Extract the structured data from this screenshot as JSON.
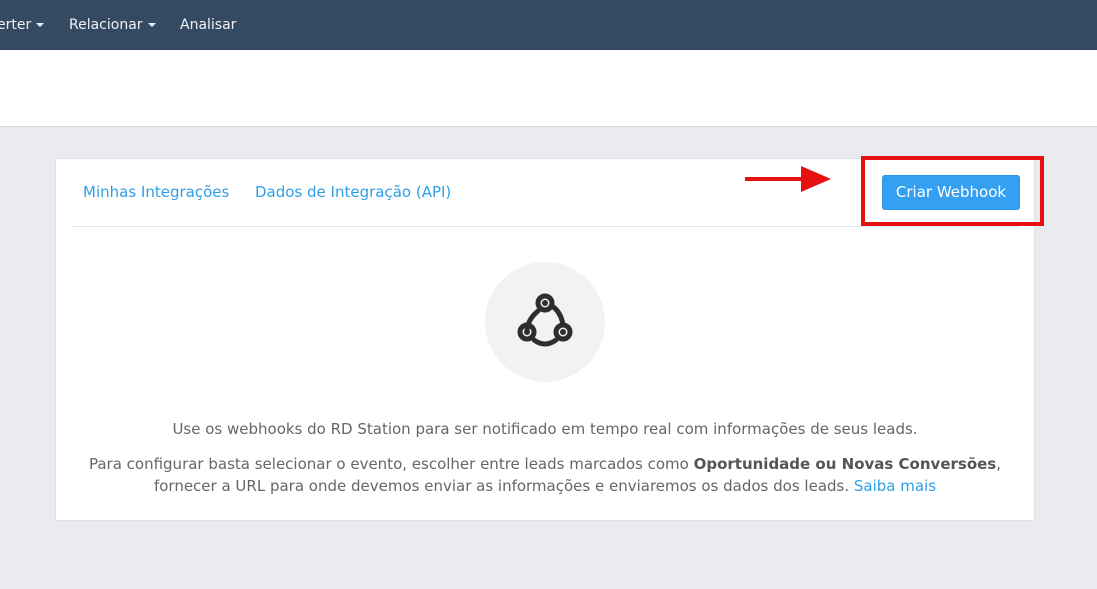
{
  "topnav": {
    "items": [
      {
        "label": "erter",
        "has_caret": true
      },
      {
        "label": "Relacionar",
        "has_caret": true
      },
      {
        "label": "Analisar",
        "has_caret": false
      }
    ]
  },
  "tabs": [
    {
      "label": "Minhas Integrações"
    },
    {
      "label": "Dados de Integração (API)"
    }
  ],
  "actions": {
    "create_label": "Criar Webhook"
  },
  "empty_state": {
    "icon": "webhook-icon",
    "line1": "Use os webhooks do RD Station para ser notificado em tempo real com informações de seus leads.",
    "line2_pre": "Para configurar basta selecionar o evento, escolher entre leads marcados como ",
    "line2_bold": "Oportunidade ou Novas Conversões",
    "line2_mid": ",",
    "line3_pre": "fornecer a URL para onde devemos enviar as informações e enviaremos os dados dos leads. ",
    "link_label": "Saiba mais"
  },
  "colors": {
    "nav_bg": "#344a63",
    "accent": "#34a0f2",
    "link": "#2e9fe6",
    "annotation": "#e51010"
  }
}
